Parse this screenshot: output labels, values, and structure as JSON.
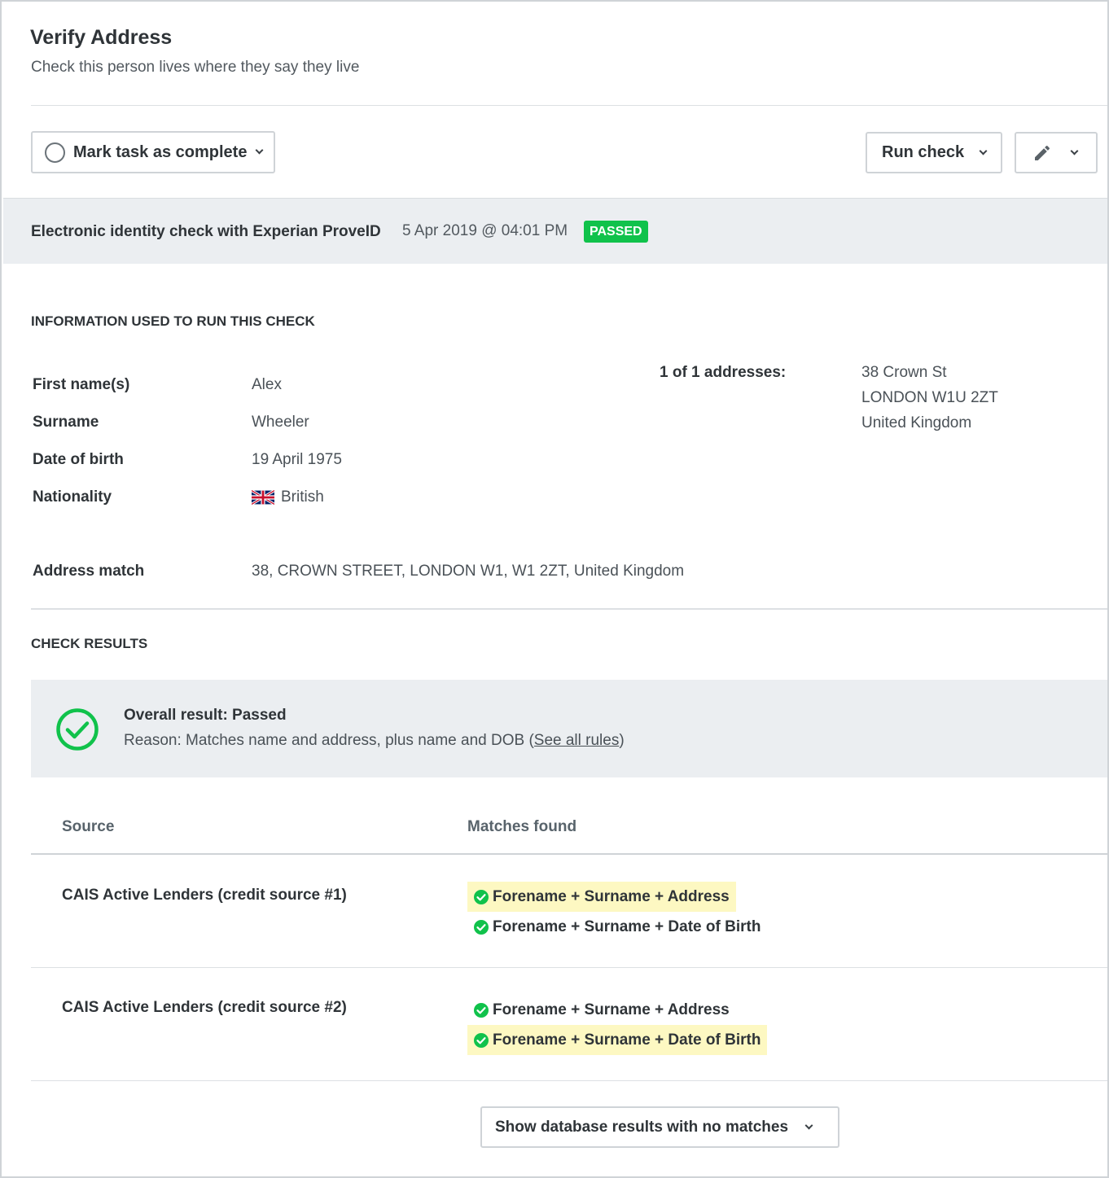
{
  "header": {
    "title": "Verify Address",
    "subtitle": "Check this person lives where they say they live"
  },
  "toolbar": {
    "mark_complete_label": "Mark task as complete",
    "run_check_label": "Run check",
    "edit_icon": "pencil-icon"
  },
  "check": {
    "name": "Electronic identity check with Experian ProveID",
    "date": "5 Apr 2019 @ 04:01 PM",
    "status": "PASSED",
    "status_color": "#10c24b"
  },
  "info": {
    "heading": "INFORMATION USED TO RUN THIS CHECK",
    "fields": [
      {
        "label": "First name(s)",
        "value": "Alex"
      },
      {
        "label": "Surname",
        "value": "Wheeler"
      },
      {
        "label": "Date of birth",
        "value": "19 April 1975"
      },
      {
        "label": "Nationality",
        "value": "British",
        "icon": "uk-flag-icon"
      }
    ],
    "addresses_label": "1 of 1 addresses:",
    "address_lines": [
      "38 Crown St",
      "LONDON W1U 2ZT",
      "United Kingdom"
    ],
    "address_match_label": "Address match",
    "address_match_value": "38, CROWN STREET, LONDON W1, W1 2ZT, United Kingdom"
  },
  "results": {
    "heading": "CHECK RESULTS",
    "overall": "Overall result: Passed",
    "reason_prefix": "Reason: Matches name and address, plus name and DOB (",
    "see_rules": "See all rules",
    "reason_suffix": ")",
    "columns": [
      "Source",
      "Matches found"
    ],
    "rows": [
      {
        "source": "CAIS Active Lenders (credit source #1)",
        "matches": [
          "Forename + Surname + Address",
          "Forename + Surname + Date of Birth"
        ]
      },
      {
        "source": "CAIS Active Lenders (credit source #2)",
        "matches": [
          "Forename + Surname + Address",
          "Forename + Surname + Date of Birth"
        ]
      }
    ],
    "highlight_color": "#fdf8c2",
    "show_no_matches_label": "Show database results with no matches"
  }
}
